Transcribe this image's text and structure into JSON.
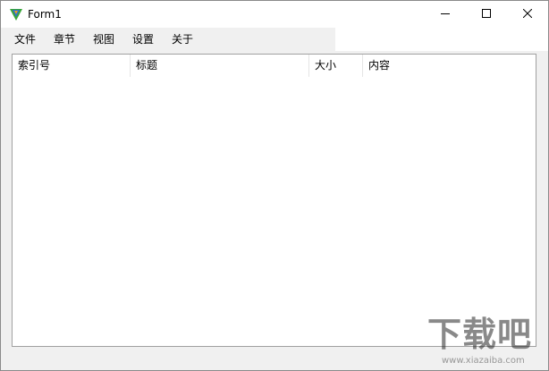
{
  "window": {
    "title": "Form1",
    "icon": "app-shield-icon",
    "controls": {
      "minimize": "minimize-icon",
      "maximize": "maximize-icon",
      "close": "close-icon"
    }
  },
  "menu": {
    "items": [
      {
        "label": "文件"
      },
      {
        "label": "章节"
      },
      {
        "label": "视图"
      },
      {
        "label": "设置"
      },
      {
        "label": "关于"
      }
    ]
  },
  "listview": {
    "columns": [
      {
        "label": "索引号"
      },
      {
        "label": "标题"
      },
      {
        "label": "大小"
      },
      {
        "label": "内容"
      }
    ],
    "rows": []
  },
  "watermark": {
    "text": "下载吧",
    "url": "www.xiazaiba.com"
  },
  "colors": {
    "window_bg": "#f0f0f0",
    "list_bg": "#ffffff",
    "icon_green": "#3aa63a",
    "icon_blue": "#2a6fd6",
    "icon_orange": "#f0a020"
  }
}
